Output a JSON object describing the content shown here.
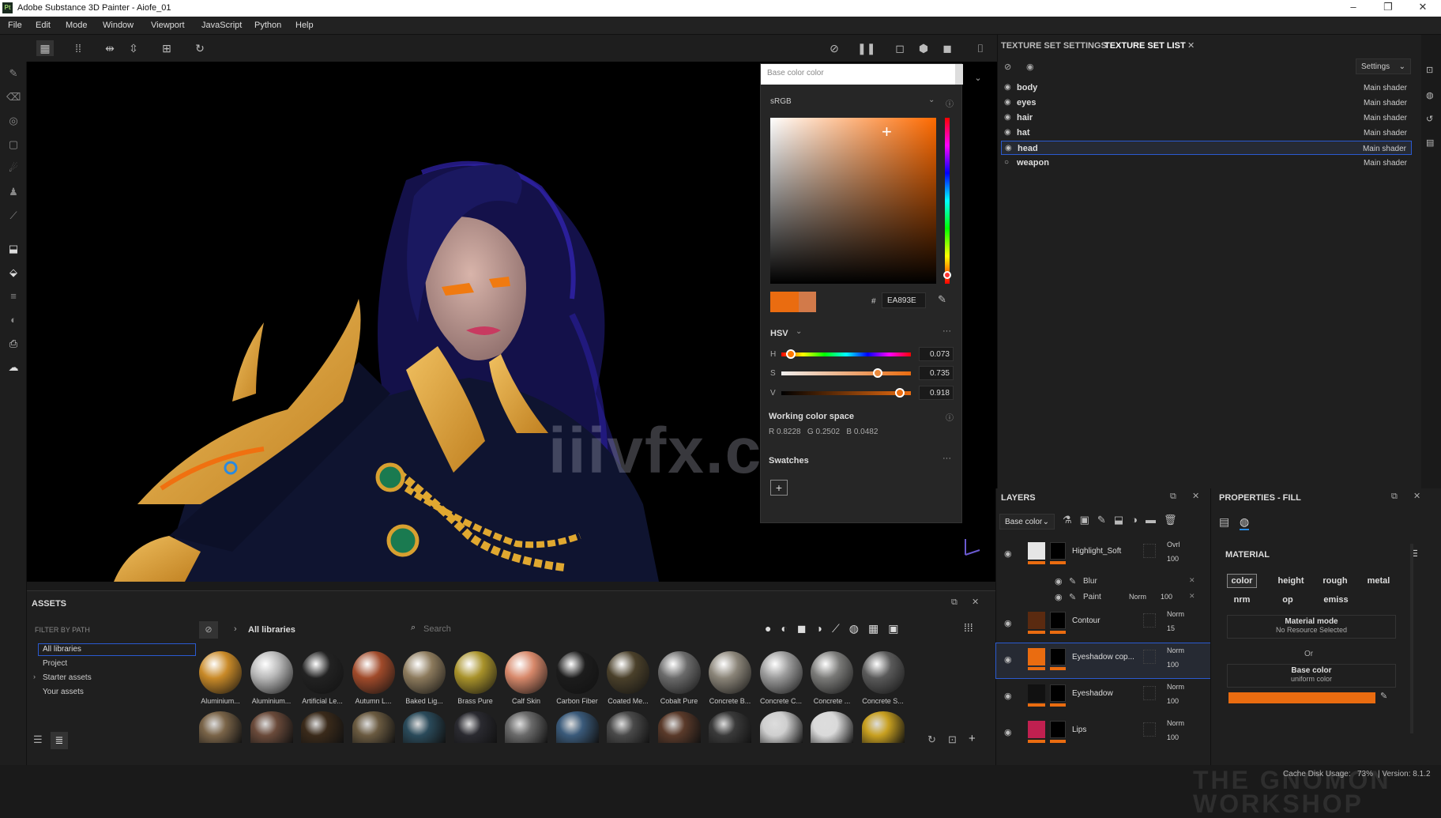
{
  "window": {
    "title": "Adobe Substance 3D Painter - Aiofe_01",
    "logo": "Pt"
  },
  "menu": [
    "File",
    "Edit",
    "Mode",
    "Window",
    "Viewport",
    "JavaScript",
    "Python",
    "Help"
  ],
  "picker": {
    "header": "Base color color",
    "colorspace": "sRGB",
    "hex_label": "#",
    "hex": "EA893E",
    "mode": "HSV",
    "h_label": "H",
    "h": "0.073",
    "s_label": "S",
    "s": "0.735",
    "v_label": "V",
    "v": "0.918",
    "working_title": "Working color space",
    "working_values": "R 0.8228   G 0.2502   B 0.0482",
    "swatches_title": "Swatches",
    "current_color": "#ea6c10",
    "previous_color": "#d27a4a"
  },
  "watermark": "iiivfx.com",
  "texture_set": {
    "tab_settings": "TEXTURE SET SETTINGS",
    "tab_list": "TEXTURE SET LIST",
    "settings_label": "Settings",
    "rows": [
      {
        "name": "body",
        "shader": "Main shader"
      },
      {
        "name": "eyes",
        "shader": "Main shader"
      },
      {
        "name": "hair",
        "shader": "Main shader"
      },
      {
        "name": "hat",
        "shader": "Main shader"
      },
      {
        "name": "head",
        "shader": "Main shader"
      },
      {
        "name": "weapon",
        "shader": "Main shader"
      }
    ]
  },
  "assets": {
    "title": "ASSETS",
    "filter_label": "FILTER BY PATH",
    "tree": [
      "All libraries",
      "Project",
      "Starter assets",
      "Your assets"
    ],
    "breadcrumb": "All libraries",
    "search_placeholder": "Search",
    "materials": [
      {
        "label": "Aluminium...",
        "color": "#c98a28"
      },
      {
        "label": "Aluminium...",
        "color": "#b8b8b8"
      },
      {
        "label": "Artificial Le...",
        "color": "#222222"
      },
      {
        "label": "Autumn L...",
        "color": "#a04a2a"
      },
      {
        "label": "Baked Lig...",
        "color": "#8c7a5c"
      },
      {
        "label": "Brass Pure",
        "color": "#a8922a"
      },
      {
        "label": "Calf Skin",
        "color": "#d7886a"
      },
      {
        "label": "Carbon Fiber",
        "color": "#1c1c1c"
      },
      {
        "label": "Coated Me...",
        "color": "#4a402a"
      },
      {
        "label": "Cobalt Pure",
        "color": "#6a6a6a"
      },
      {
        "label": "Concrete B...",
        "color": "#8a8478"
      },
      {
        "label": "Concrete C...",
        "color": "#9a9a9a"
      },
      {
        "label": "Concrete ...",
        "color": "#7a7a78"
      },
      {
        "label": "Concrete S...",
        "color": "#5a5a5a"
      }
    ],
    "row2_colors": [
      "#7a6448",
      "#6a4a3a",
      "#3a2a1a",
      "#6a5a40",
      "#2a4a5a",
      "#2a2a30",
      "#6a6a6a",
      "#3a5a7a",
      "#4a4a4a",
      "#5a3a2a",
      "#3a3a3a",
      "#cfcfcf",
      "#dadada",
      "#c8a020"
    ]
  },
  "layers": {
    "title": "LAYERS",
    "channel": "Base color",
    "items": [
      {
        "name": "Highlight_Soft",
        "blend": "Ovrl",
        "opacity": "100",
        "thumb": "#e6e6e6"
      },
      {
        "name": "Blur",
        "sub": true
      },
      {
        "name": "Paint",
        "sub": true,
        "blend": "Norm",
        "opacity": "100"
      },
      {
        "name": "Contour",
        "blend": "Norm",
        "opacity": "15",
        "thumb": "#5a2a10"
      },
      {
        "name": "Eyeshadow cop...",
        "blend": "Norm",
        "opacity": "100",
        "thumb": "#ea6c10"
      },
      {
        "name": "Eyeshadow",
        "blend": "Norm",
        "opacity": "100",
        "thumb": "#111111"
      },
      {
        "name": "Lips",
        "blend": "Norm",
        "opacity": "100",
        "thumb": "#c02050"
      }
    ]
  },
  "properties": {
    "title": "PROPERTIES - FILL",
    "material_title": "MATERIAL",
    "channels": [
      "color",
      "height",
      "rough",
      "metal",
      "nrm",
      "op",
      "emiss"
    ],
    "mode_title": "Material mode",
    "mode_sub": "No Resource Selected",
    "or_label": "Or",
    "base_title": "Base color",
    "base_sub": "uniform color",
    "base_swatch": "#ea6c10"
  },
  "status": {
    "cache": "Cache Disk Usage:",
    "cache_pct": "73%",
    "version": "| Version: 8.1.2",
    "brand": "THE GNOMON WORKSHOP"
  }
}
